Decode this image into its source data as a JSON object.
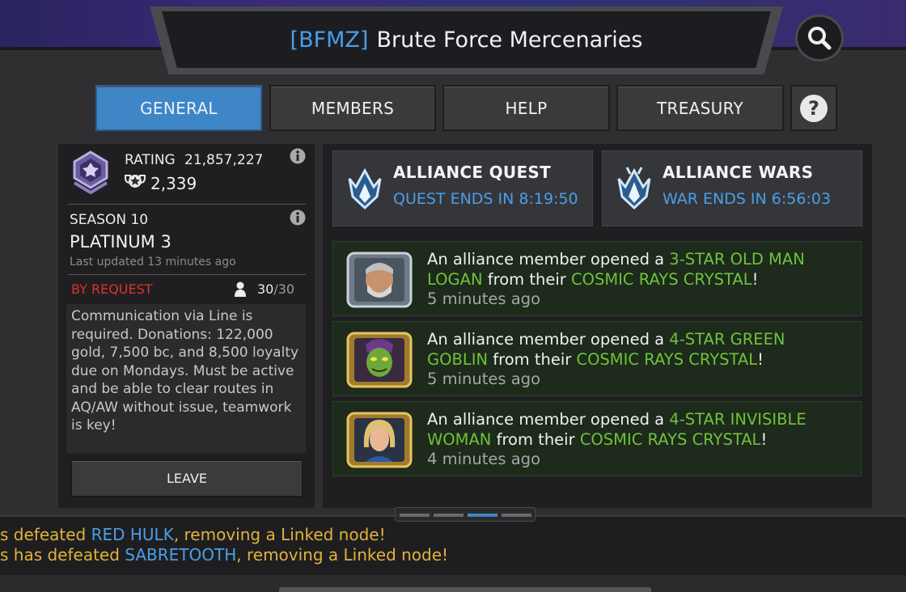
{
  "header": {
    "alliance_tag": "[BFMZ]",
    "alliance_name": "Brute Force Mercenaries"
  },
  "tabs": [
    {
      "label": "GENERAL",
      "active": true
    },
    {
      "label": "MEMBERS",
      "active": false
    },
    {
      "label": "HELP",
      "active": false
    },
    {
      "label": "TREASURY",
      "active": false
    }
  ],
  "summary": {
    "rating_label": "RATING",
    "rating_value": "21,857,227",
    "trophy_value": "2,339",
    "season": "SEASON 10",
    "tier": "PLATINUM 3",
    "last_updated": "Last updated 13 minutes ago",
    "join_mode": "BY REQUEST",
    "member_count": "30",
    "member_max": "/30",
    "description": "Communication via Line is required. Donations: 122,000 gold, 7,500 bc, and 8,500 loyalty due on Mondays. Must be active and be able to clear routes in AQ/AW without issue, teamwork is key!",
    "leave_label": "LEAVE"
  },
  "events": [
    {
      "title": "ALLIANCE QUEST",
      "timer": "QUEST ENDS IN 8:19:50",
      "icon": "alliance-quest-icon"
    },
    {
      "title": "ALLIANCE WARS",
      "timer": "WAR ENDS IN 6:56:03",
      "icon": "alliance-wars-icon"
    }
  ],
  "feed": [
    {
      "prefix": "An alliance member opened a ",
      "champion": "3-STAR OLD MAN LOGAN",
      "middle": " from their ",
      "crystal": "COSMIC RAYS CRYSTAL",
      "suffix": "!",
      "time": "5 minutes ago",
      "portrait": "old-man-logan-portrait"
    },
    {
      "prefix": "An alliance member opened a ",
      "champion": "4-STAR GREEN GOBLIN",
      "middle": " from their ",
      "crystal": "COSMIC RAYS CRYSTAL",
      "suffix": "!",
      "time": "5 minutes ago",
      "portrait": "green-goblin-portrait"
    },
    {
      "prefix": "An alliance member opened a ",
      "champion": "4-STAR INVISIBLE WOMAN",
      "middle": " from their ",
      "crystal": "COSMIC RAYS CRYSTAL",
      "suffix": "!",
      "time": "4 minutes ago",
      "portrait": "invisible-woman-portrait"
    }
  ],
  "pager": {
    "pages": 4,
    "active": 3
  },
  "ticker": [
    {
      "prefix": "s defeated ",
      "name": "RED HULK",
      "suffix": ", removing a Linked node!"
    },
    {
      "prefix": "s has defeated ",
      "name": "SABRETOOTH",
      "suffix": ", removing a Linked node!"
    }
  ],
  "colors": {
    "accent_blue": "#4b9ee8",
    "tab_active": "#3f86c6",
    "highlight_green": "#6fc23a",
    "request_red": "#e0312f",
    "ticker_gold": "#e2b23a",
    "feed_bg": "#1d2a1c"
  }
}
